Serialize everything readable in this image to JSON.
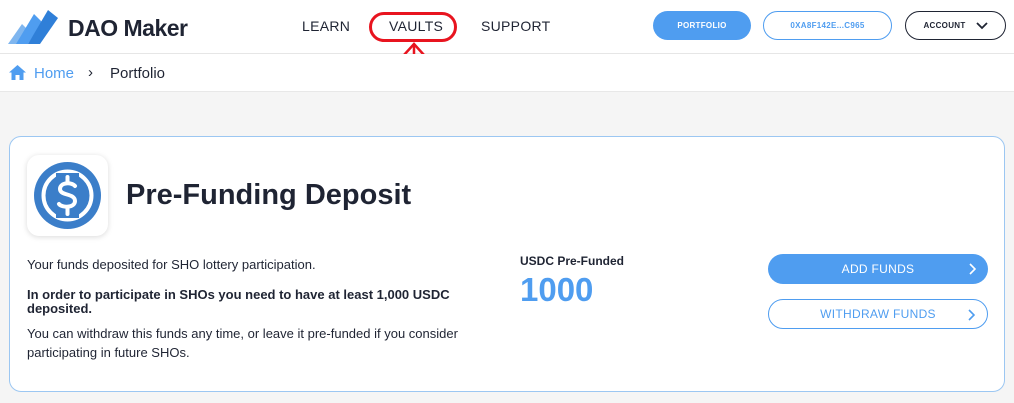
{
  "header": {
    "brand": "DAO Maker",
    "nav": {
      "learn": "LEARN",
      "vaults": "VAULTS",
      "support": "SUPPORT"
    },
    "portfolio_button": "PORTFOLIO",
    "wallet_button": "0XA8F142E...C965",
    "account_button": "ACCOUNT"
  },
  "breadcrumb": {
    "home": "Home",
    "separator": "›",
    "current": "Portfolio"
  },
  "card": {
    "title": "Pre-Funding Deposit",
    "desc1": "Your funds deposited for SHO lottery participation.",
    "desc2": "In order to participate in SHOs you need to have at least 1,000 USDC deposited.",
    "desc3": "You can withdraw this funds any time, or leave it pre-funded if you consider participating in future SHOs.",
    "funded_label": "USDC Pre-Funded",
    "funded_value": "1000",
    "add_funds": "ADD FUNDS",
    "withdraw_funds": "WITHDRAW FUNDS"
  },
  "colors": {
    "accent": "#4f9df0",
    "annotation": "#e8141f",
    "text": "#1f2433"
  },
  "icons": {
    "logo": "dao-maker-logo",
    "home": "home-icon",
    "coin": "usdc-coin-icon",
    "chevron": "chevron-right-icon"
  }
}
